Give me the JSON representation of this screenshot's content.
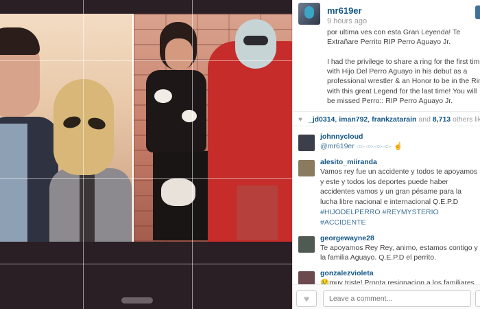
{
  "post": {
    "username": "mr619er",
    "follow_label": "Fo",
    "time": "9 hours ago",
    "caption": "por ultima ves con esta Gran Leyenda! Te Extrañare Perrito RIP Perro Aguayo Jr.\n\nI had the privilege to share a ring for the first time with Hijo Del Perro Aguayo in his debut as a professional wrestler & an Honor to be in the Ring with this great Legend for the last time! You will be missed Perro:: RIP Perro Aguayo Jr."
  },
  "likes": {
    "users": [
      "_jd0314",
      "iman792",
      "frankzatarain"
    ],
    "and_text": "and",
    "count": "8,713",
    "rest": "others like this"
  },
  "comments": [
    {
      "user": "johnnycloud",
      "text": "@mr619er 𓁹𓁹𓁹𓁹 ☝",
      "avatar_color": "#3b3f4a"
    },
    {
      "user": "alesito_miiranda",
      "text": "Vamos rey fue un accidente y todos te apoyamos y este y todos los deportes puede haber accidentes vamos y un gran pésame para la lucha libre nacional e internacional Q.E.P.D",
      "tags": "#HIJODELPERRO #REYMYSTERIO #ACCIDENTE",
      "avatar_color": "#8a7a5e"
    },
    {
      "user": "georgewayne28",
      "text": "Te apoyamos Rey Rey, animo, estamos contigo y la familia Aguayo. Q.E.P.D el perrito.",
      "avatar_color": "#4e5a52"
    },
    {
      "user": "gonzalezvioleta",
      "text": "😢muy triste! Pronta resignacion a los familiares",
      "avatar_color": "#6a4a4f"
    }
  ],
  "footer": {
    "comment_placeholder": "Leave a comment..."
  },
  "icons": {
    "heart": "heart-icon"
  },
  "colors": {
    "link": "#125688",
    "follow_button": "#3f729b",
    "hashtag": "#3f729b"
  }
}
